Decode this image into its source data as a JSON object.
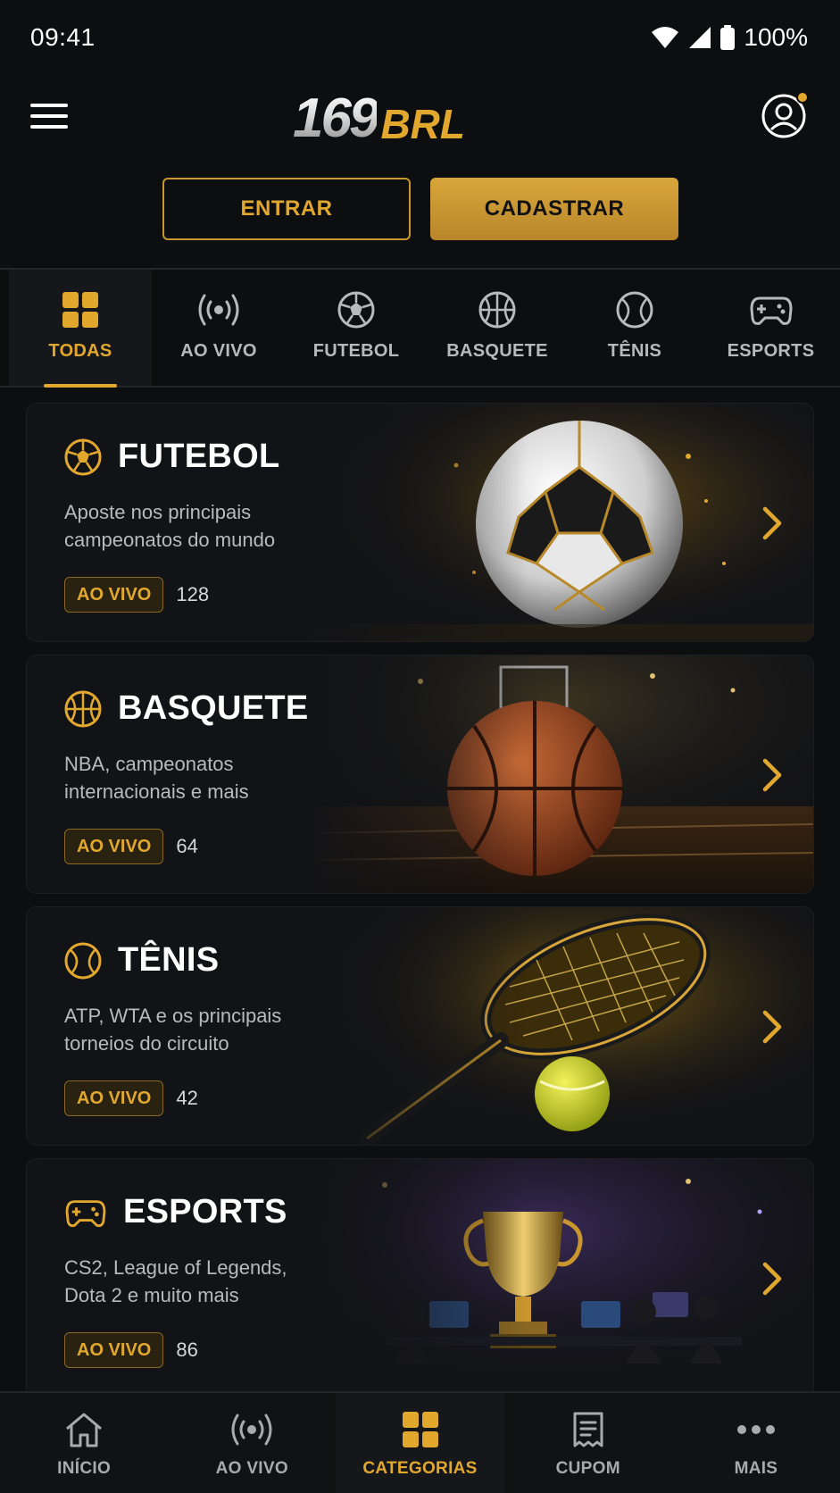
{
  "status_bar": {
    "time": "09:41",
    "battery": "100%"
  },
  "header": {
    "logo_number": "169",
    "logo_suffix": "BRL",
    "menu_icon": "hamburger-icon",
    "profile_icon": "user-circle-icon"
  },
  "auth": {
    "login_label": "ENTRAR",
    "register_label": "CADASTRAR"
  },
  "tabs": [
    {
      "label": "TODAS",
      "icon": "grid-icon",
      "active": true
    },
    {
      "label": "AO VIVO",
      "icon": "broadcast-icon",
      "active": false
    },
    {
      "label": "FUTEBOL",
      "icon": "soccer-ball-icon",
      "active": false
    },
    {
      "label": "BASQUETE",
      "icon": "basketball-icon",
      "active": false
    },
    {
      "label": "TÊNIS",
      "icon": "tennis-ball-icon",
      "active": false
    },
    {
      "label": "ESPORTS",
      "icon": "gamepad-icon",
      "active": false
    }
  ],
  "cards": [
    {
      "title": "FUTEBOL",
      "description": "Aposte nos principais campeonatos do mundo",
      "badge": "AO VIVO",
      "count": "128",
      "icon": "soccer-ball-icon"
    },
    {
      "title": "BASQUETE",
      "description": "NBA, campeonatos internacionais e mais",
      "badge": "AO VIVO",
      "count": "64",
      "icon": "basketball-icon"
    },
    {
      "title": "TÊNIS",
      "description": "ATP, WTA e os principais torneios do circuito",
      "badge": "AO VIVO",
      "count": "42",
      "icon": "tennis-ball-icon"
    },
    {
      "title": "ESPORTS",
      "description": "CS2, League of Legends, Dota 2 e muito mais",
      "badge": "AO VIVO",
      "count": "86",
      "icon": "gamepad-icon"
    }
  ],
  "bottom_nav": [
    {
      "label": "INÍCIO",
      "icon": "home-icon",
      "active": false
    },
    {
      "label": "AO VIVO",
      "icon": "broadcast-icon",
      "active": false
    },
    {
      "label": "CATEGORIAS",
      "icon": "grid-icon",
      "active": true
    },
    {
      "label": "CUPOM",
      "icon": "receipt-icon",
      "active": false
    },
    {
      "label": "MAIS",
      "icon": "more-icon",
      "active": false
    }
  ],
  "colors": {
    "accent": "#e2a82e",
    "background": "#0d0e10",
    "card": "#121316",
    "muted_text": "#b9babe"
  }
}
